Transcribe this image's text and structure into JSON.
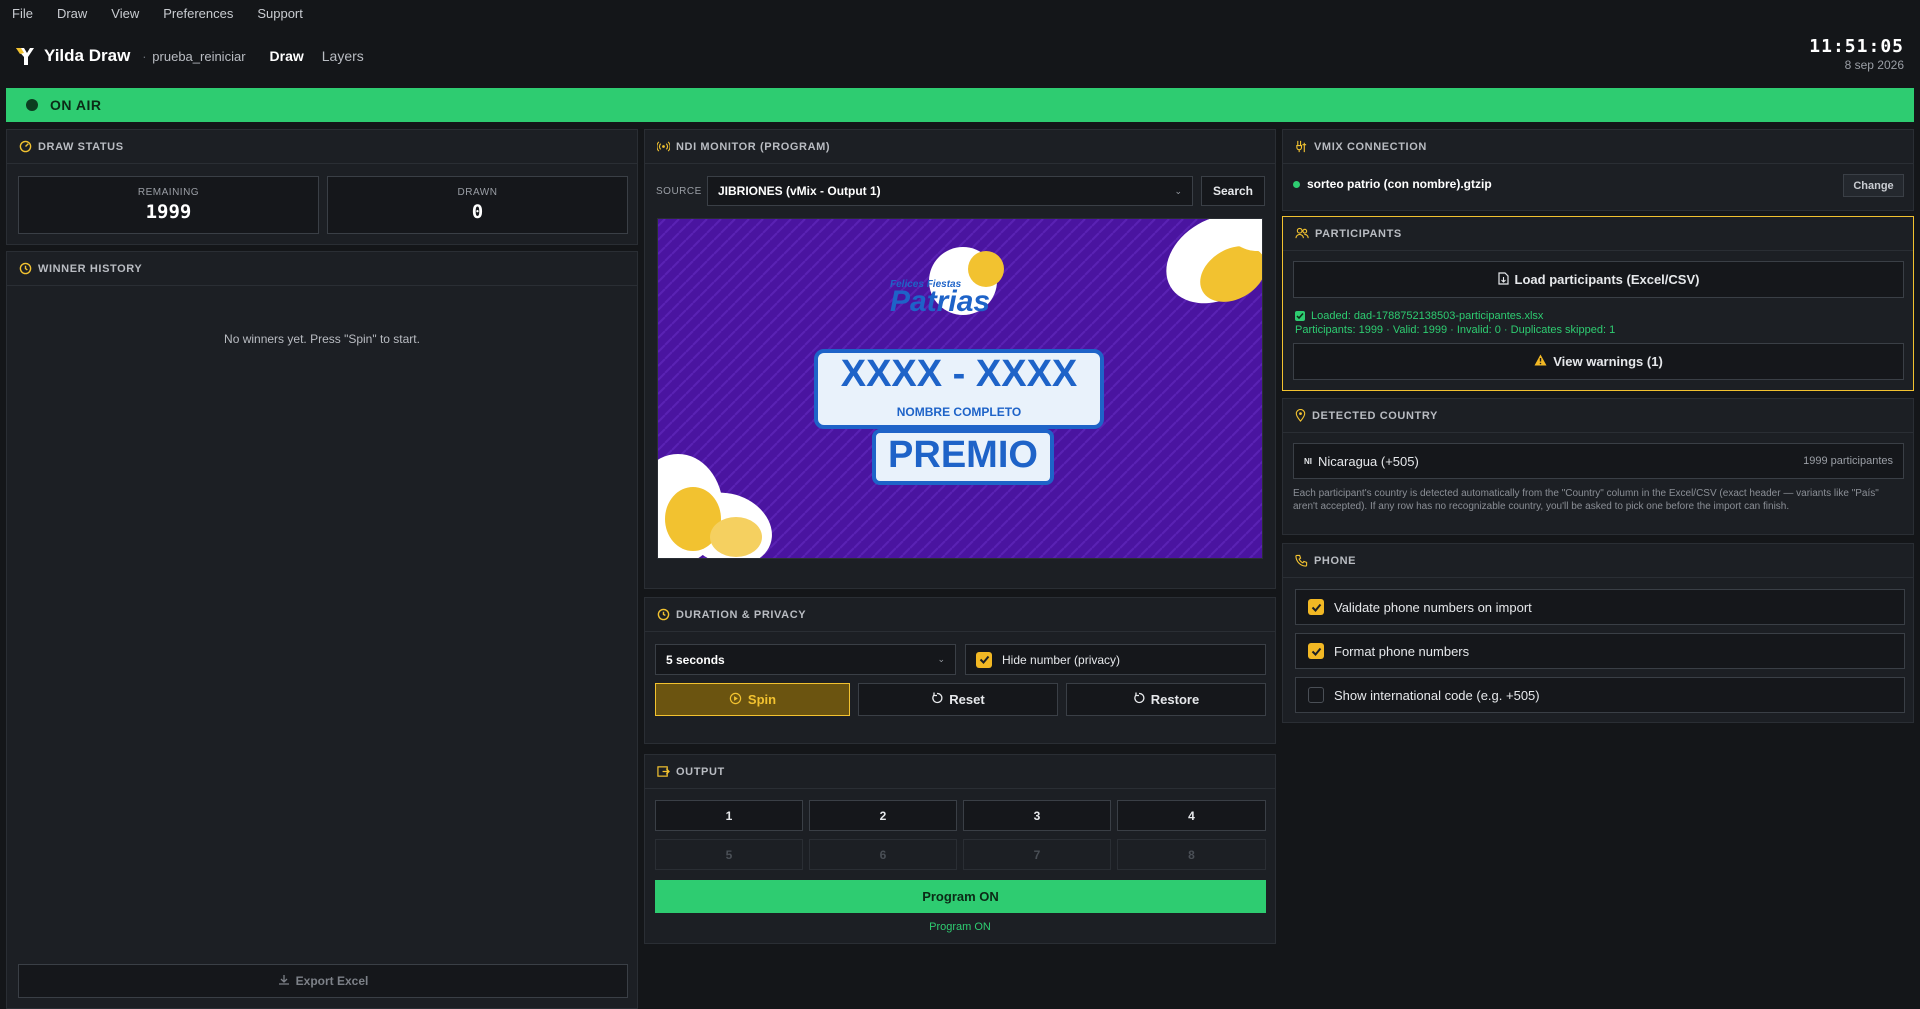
{
  "menu": [
    "File",
    "Draw",
    "View",
    "Preferences",
    "Support"
  ],
  "app": {
    "name": "Yilda Draw",
    "project": "prueba_reiniciar",
    "nav_draw": "Draw",
    "nav_layers": "Layers"
  },
  "clock": {
    "time": "11:51:05",
    "date": "8 sep 2026"
  },
  "onair": {
    "label": "ON AIR"
  },
  "draw_status": {
    "title": "DRAW STATUS",
    "remaining_label": "REMAINING",
    "remaining_value": "1999",
    "drawn_label": "DRAWN",
    "drawn_value": "0"
  },
  "winner_history": {
    "title": "WINNER HISTORY",
    "empty_text": "No winners yet. Press \"Spin\" to start.",
    "export_label": "Export Excel"
  },
  "ndi": {
    "title": "NDI MONITOR (PROGRAM)",
    "source_label": "SOURCE",
    "source_value": "JIBRIONES (vMix - Output 1)",
    "search_label": "Search",
    "preview": {
      "logo_small": "Felices Fiestas",
      "logo_big": "Patrias",
      "number": "XXXX - XXXX",
      "name": "NOMBRE COMPLETO",
      "prize": "PREMIO"
    }
  },
  "duration": {
    "title": "DURATION & PRIVACY",
    "value": "5 seconds",
    "hide_label": "Hide number (privacy)",
    "hide_checked": true,
    "spin": "Spin",
    "reset": "Reset",
    "restore": "Restore"
  },
  "output": {
    "title": "OUTPUT",
    "buttons": [
      "1",
      "2",
      "3",
      "4",
      "5",
      "6",
      "7",
      "8"
    ],
    "program_btn": "Program ON",
    "program_status": "Program ON"
  },
  "vmix": {
    "title": "VMIX CONNECTION",
    "file": "sorteo patrio (con nombre).gtzip",
    "change": "Change"
  },
  "participants": {
    "title": "PARTICIPANTS",
    "load_label": "Load participants (Excel/CSV)",
    "loaded_text": "Loaded: dad-1788752138503-participantes.xlsx",
    "stats_text": "Participants: 1999 · Valid: 1999 · Invalid: 0 · Duplicates skipped: 1",
    "warnings_label": "View warnings (1)"
  },
  "country": {
    "title": "DETECTED COUNTRY",
    "flag": "NI",
    "name": "Nicaragua (+505)",
    "count": "1999 participantes",
    "help": "Each participant's country is detected automatically from the \"Country\" column in the Excel/CSV (exact header — variants like \"País\" aren't accepted). If any row has no recognizable country, you'll be asked to pick one before the import can finish."
  },
  "phone": {
    "title": "PHONE",
    "options": [
      {
        "label": "Validate phone numbers on import",
        "checked": true
      },
      {
        "label": "Format phone numbers",
        "checked": true
      },
      {
        "label": "Show international code (e.g. +505)",
        "checked": false
      }
    ]
  },
  "colors": {
    "accent": "#f2c230",
    "onair": "#2ecc71",
    "bg": "#141619",
    "panel": "#1c1f24",
    "preview_bg": "#4a14a0"
  }
}
